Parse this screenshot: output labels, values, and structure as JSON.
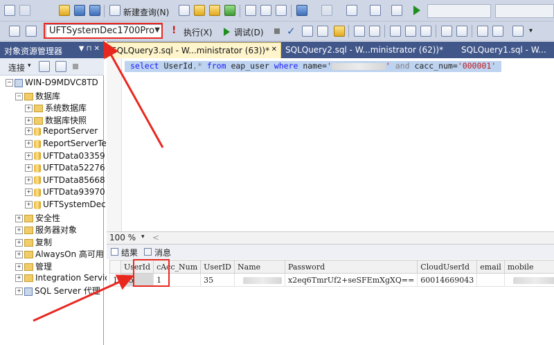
{
  "toolbar1": {
    "new_query_label": "新建查询(N)"
  },
  "toolbar2": {
    "database_selector": "UFTSystemDec1700Pro",
    "execute_label": "执行(X)",
    "debug_label": "调试(D)"
  },
  "object_explorer": {
    "title": "对象资源管理器",
    "pin_chars": "▼ ⊓ ✕",
    "connect_label": "连接",
    "tree": [
      {
        "label": "WIN-D9MDVC8TD",
        "level": 0,
        "icon": "server-icon",
        "expander": "−"
      },
      {
        "label": "数据库",
        "level": 1,
        "icon": "folder-icon",
        "expander": "−"
      },
      {
        "label": "系统数据库",
        "level": 2,
        "icon": "folder-icon",
        "expander": "+"
      },
      {
        "label": "数据库快照",
        "level": 2,
        "icon": "folder-icon",
        "expander": "+"
      },
      {
        "label": "ReportServer",
        "level": 2,
        "icon": "database-icon",
        "expander": "+"
      },
      {
        "label": "ReportServerTe",
        "level": 2,
        "icon": "database-icon",
        "expander": "+"
      },
      {
        "label": "UFTData03359",
        "level": 2,
        "icon": "database-icon",
        "expander": "+"
      },
      {
        "label": "UFTData52276",
        "level": 2,
        "icon": "database-icon",
        "expander": "+"
      },
      {
        "label": "UFTData85668",
        "level": 2,
        "icon": "database-icon",
        "expander": "+"
      },
      {
        "label": "UFTData93970",
        "level": 2,
        "icon": "database-icon",
        "expander": "+"
      },
      {
        "label": "UFTSystemDec",
        "level": 2,
        "icon": "database-icon",
        "expander": "+"
      },
      {
        "label": "安全性",
        "level": 1,
        "icon": "folder-icon",
        "expander": "+"
      },
      {
        "label": "服务器对象",
        "level": 1,
        "icon": "folder-icon",
        "expander": "+"
      },
      {
        "label": "复制",
        "level": 1,
        "icon": "folder-icon",
        "expander": "+"
      },
      {
        "label": "AlwaysOn 高可用",
        "level": 1,
        "icon": "folder-icon",
        "expander": "+"
      },
      {
        "label": "管理",
        "level": 1,
        "icon": "folder-icon",
        "expander": "+"
      },
      {
        "label": "Integration Servic",
        "level": 1,
        "icon": "folder-icon",
        "expander": "+"
      },
      {
        "label": "SQL Server 代理",
        "level": 1,
        "icon": "agent-icon",
        "expander": "+"
      }
    ]
  },
  "tabs": [
    {
      "label": "SQLQuery3.sql - W...ministrator (63))*",
      "close": "✕",
      "active": true
    },
    {
      "label": "SQLQuery2.sql - W...ministrator (62))*",
      "active": false
    },
    {
      "label": "SQLQuery1.sql - W...",
      "active": false
    }
  ],
  "editor": {
    "sql": {
      "kw_select": "select",
      "col1": " UserId",
      "star": ",*",
      "kw_from": "from",
      "table": " eap_user",
      "kw_where": "where",
      "name_part": " name=",
      "name_value": "'",
      "kw_and": "and",
      "cacc_part": " cacc_num=",
      "cacc_value": "'000001'"
    }
  },
  "zoom": {
    "value": "100 %"
  },
  "results_tabs": {
    "results_label": "结果",
    "messages_label": "消息"
  },
  "results": {
    "columns": [
      "UserId",
      "cAcc_Num",
      "UserID",
      "Name",
      "Password",
      "CloudUserId",
      "email",
      "mobile"
    ],
    "rows": [
      {
        "row_number": "1",
        "UserId": "35",
        "cAcc_Num": "1",
        "UserID": "35",
        "Name": "",
        "Password": "x2eq6TmrUf2+seSFEmXgXQ==",
        "CloudUserId": "60014669043",
        "email": "",
        "mobile": ""
      }
    ]
  },
  "colors": {
    "annotation_red": "#e8271f",
    "explorer_header": "#41578a",
    "toolbar_bg": "#cfd6e5",
    "selection_blue": "#bed3ef"
  }
}
